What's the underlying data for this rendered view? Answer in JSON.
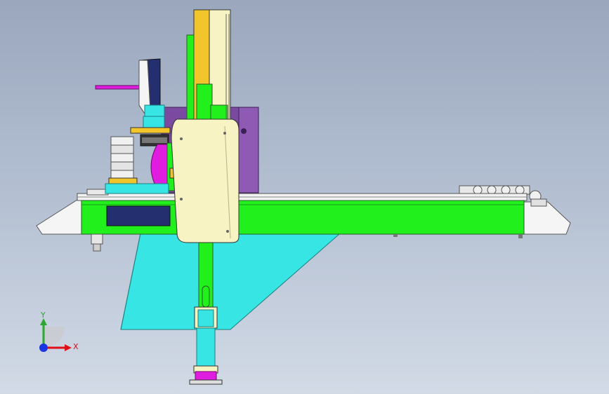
{
  "triad": {
    "y_label": "Y",
    "x_label": "X",
    "colors": {
      "x": "#e0101a",
      "y": "#2aa830",
      "origin": "#1a36e0"
    }
  },
  "palette": {
    "background_top": "#9aa7bd",
    "background_bottom": "#d2dae6",
    "green": "#22f01c",
    "cyan": "#37e6e4",
    "yellow": "#f2c52a",
    "cream": "#f7f3c2",
    "purple": "#7a4aa0",
    "magenta": "#e01ce0",
    "navy": "#232f6f",
    "white": "#f5f5f5"
  }
}
